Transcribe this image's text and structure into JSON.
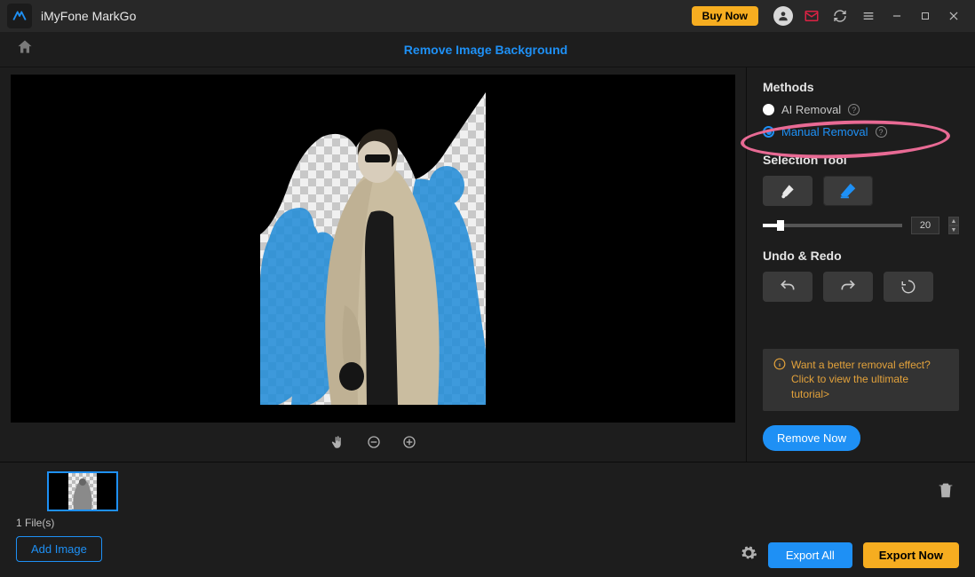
{
  "titlebar": {
    "app_name": "iMyFone MarkGo",
    "buy_now": "Buy Now"
  },
  "breadcrumb": {
    "page_title": "Remove Image Background"
  },
  "panel": {
    "methods_h": "Methods",
    "method_ai": "AI Removal",
    "method_manual": "Manual Removal",
    "selection_h": "Selection Tool",
    "slider_value": "20",
    "undo_h": "Undo & Redo",
    "tip_text": "Want a better removal effect? Click to view the ultimate tutorial>",
    "remove_now": "Remove Now"
  },
  "footer": {
    "file_count": "1 File(s)",
    "add_image": "Add Image",
    "export_all": "Export All",
    "export_now": "Export Now"
  }
}
